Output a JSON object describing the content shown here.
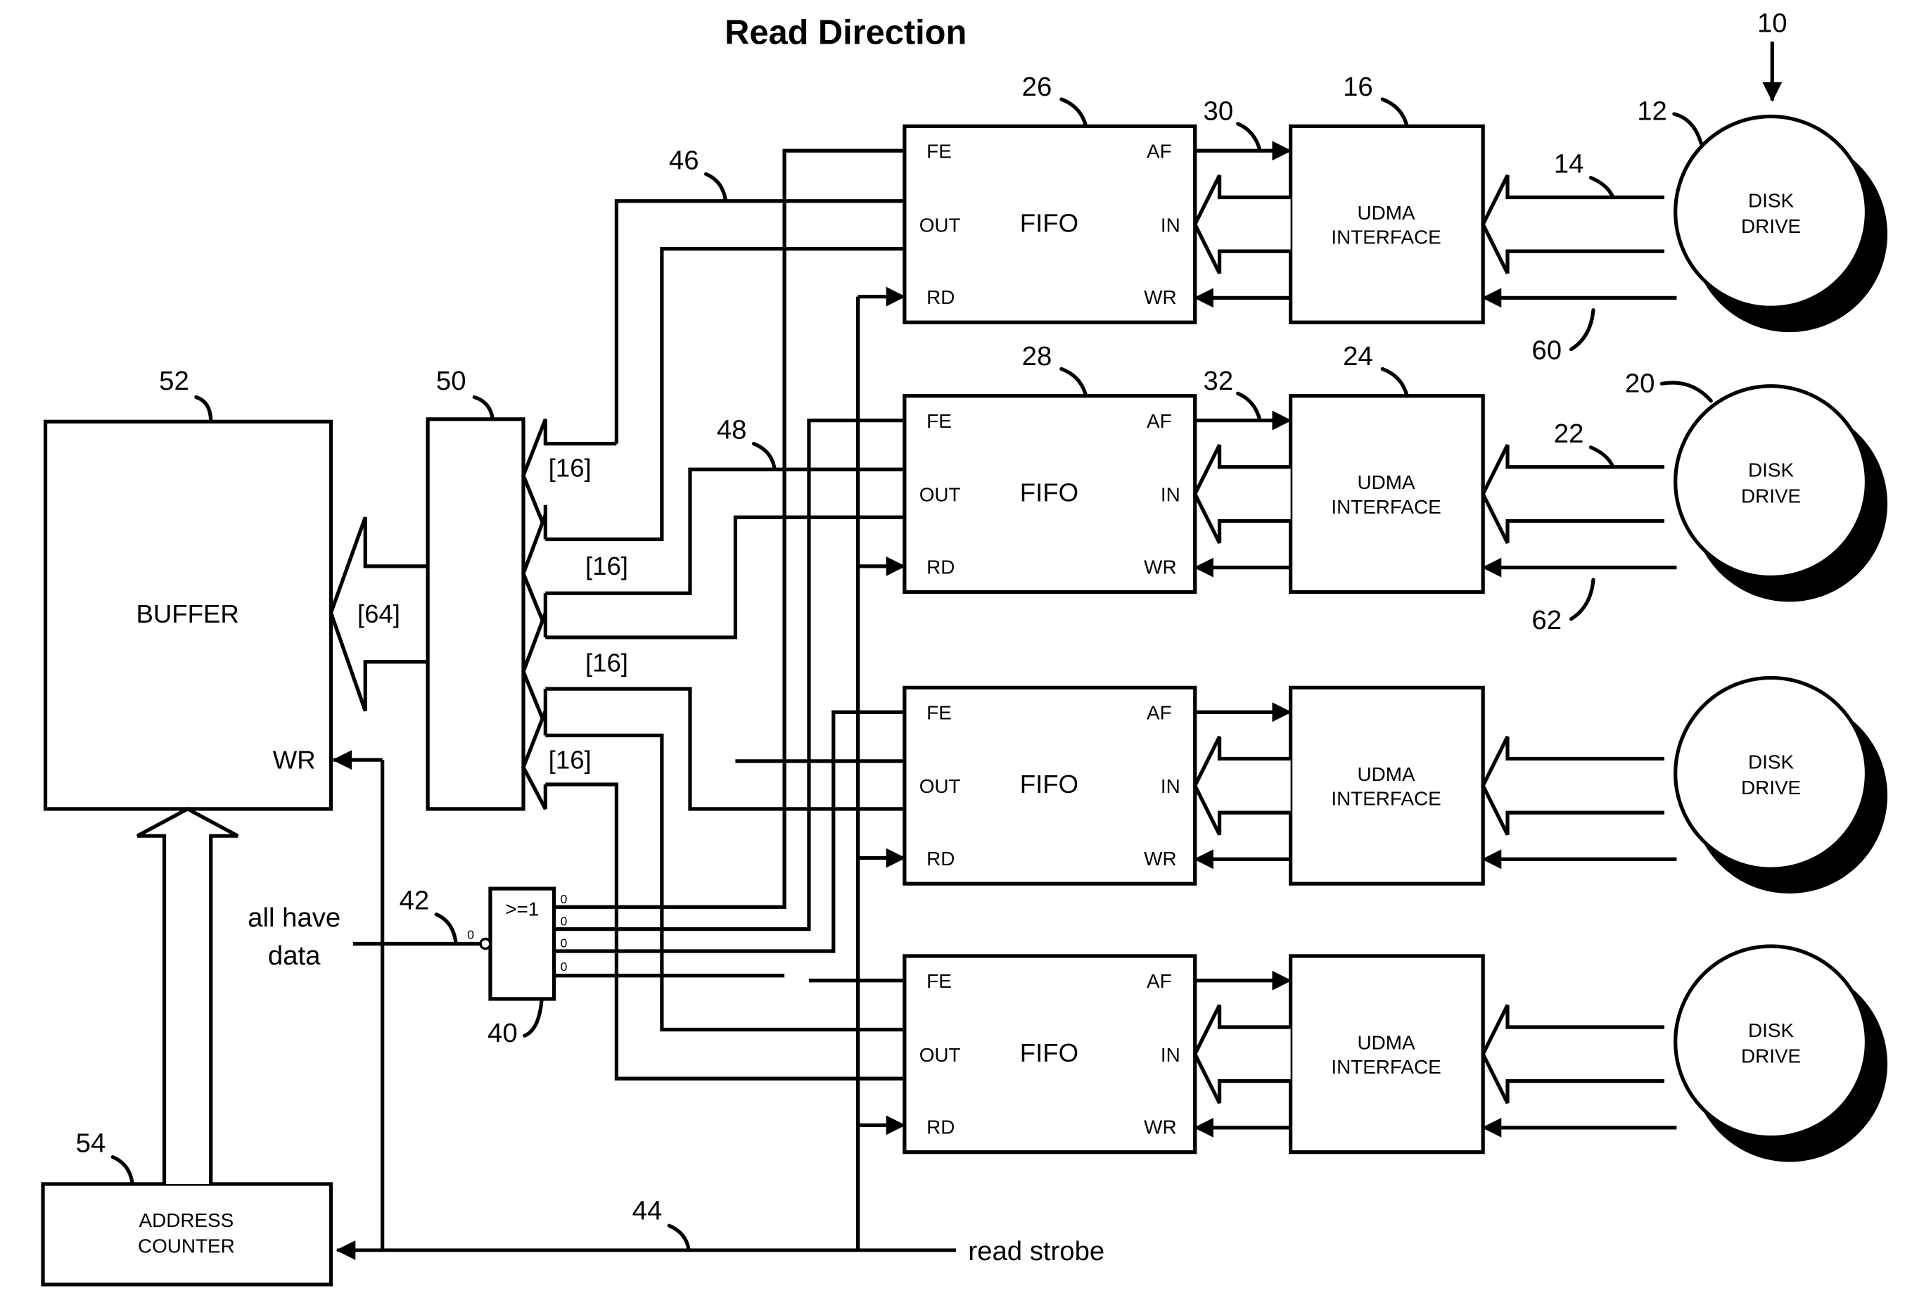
{
  "title": "Read Direction",
  "system_ref": "10",
  "buffer": {
    "ref": "52",
    "label": "BUFFER",
    "wr_label": "WR",
    "bus_width": "[64]"
  },
  "mux": {
    "ref": "50",
    "input_widths": [
      "[16]",
      "[16]",
      "[16]",
      "[16]"
    ]
  },
  "address_counter": {
    "ref": "54",
    "line1": "ADDRESS",
    "line2": "COUNTER"
  },
  "or_gate": {
    "ref": "40",
    "label": ">=1",
    "input_marks": [
      "0",
      "0",
      "0",
      "0"
    ],
    "output_mark": "0"
  },
  "signals": {
    "all_have_data_line1": "all have",
    "all_have_data_line2": "data",
    "all_have_data_ref": "42",
    "read_strobe": "read strobe",
    "read_strobe_ref": "44",
    "out_bus_1_ref": "46",
    "out_bus_2_ref": "48"
  },
  "channels": [
    {
      "fifo": {
        "ref": "26",
        "label": "FIFO",
        "pins": {
          "fe": "FE",
          "out": "OUT",
          "rd": "RD",
          "af": "AF",
          "in": "IN",
          "wr": "WR"
        }
      },
      "af_ref": "30",
      "udma": {
        "ref": "16",
        "line1": "UDMA",
        "line2": "INTERFACE"
      },
      "data_ref": "14",
      "strobe_ref": "60",
      "disk": {
        "ref": "12",
        "line1": "DISK",
        "line2": "DRIVE"
      }
    },
    {
      "fifo": {
        "ref": "28",
        "label": "FIFO",
        "pins": {
          "fe": "FE",
          "out": "OUT",
          "rd": "RD",
          "af": "AF",
          "in": "IN",
          "wr": "WR"
        }
      },
      "af_ref": "32",
      "udma": {
        "ref": "24",
        "line1": "UDMA",
        "line2": "INTERFACE"
      },
      "data_ref": "22",
      "strobe_ref": "62",
      "disk": {
        "ref": "20",
        "line1": "DISK",
        "line2": "DRIVE"
      }
    },
    {
      "fifo": {
        "ref": "",
        "label": "FIFO",
        "pins": {
          "fe": "FE",
          "out": "OUT",
          "rd": "RD",
          "af": "AF",
          "in": "IN",
          "wr": "WR"
        }
      },
      "af_ref": "",
      "udma": {
        "ref": "",
        "line1": "UDMA",
        "line2": "INTERFACE"
      },
      "data_ref": "",
      "strobe_ref": "",
      "disk": {
        "ref": "",
        "line1": "DISK",
        "line2": "DRIVE"
      }
    },
    {
      "fifo": {
        "ref": "",
        "label": "FIFO",
        "pins": {
          "fe": "FE",
          "out": "OUT",
          "rd": "RD",
          "af": "AF",
          "in": "IN",
          "wr": "WR"
        }
      },
      "af_ref": "",
      "udma": {
        "ref": "",
        "line1": "UDMA",
        "line2": "INTERFACE"
      },
      "data_ref": "",
      "strobe_ref": "",
      "disk": {
        "ref": "",
        "line1": "DISK",
        "line2": "DRIVE"
      }
    }
  ]
}
